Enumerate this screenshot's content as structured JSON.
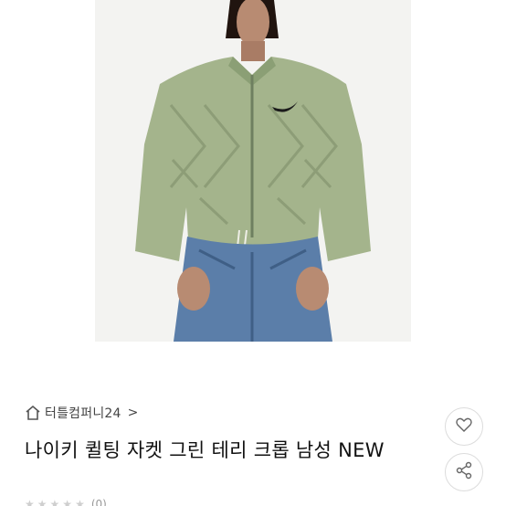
{
  "product": {
    "image_icon": "product-photo",
    "shop_name": "터틀컴퍼니24",
    "shop_chevron": ">",
    "title": "나이키 퀼팅 자켓 그린 테리 크롭 남성 NEW",
    "rating_count": "(0)"
  },
  "icons": {
    "home": "house-icon",
    "like": "heart-icon",
    "share": "share-icon"
  },
  "colors": {
    "jacket": "#a4b48c",
    "denim": "#5b7ea9",
    "background": "#f3f3f1",
    "text": "#111111"
  }
}
